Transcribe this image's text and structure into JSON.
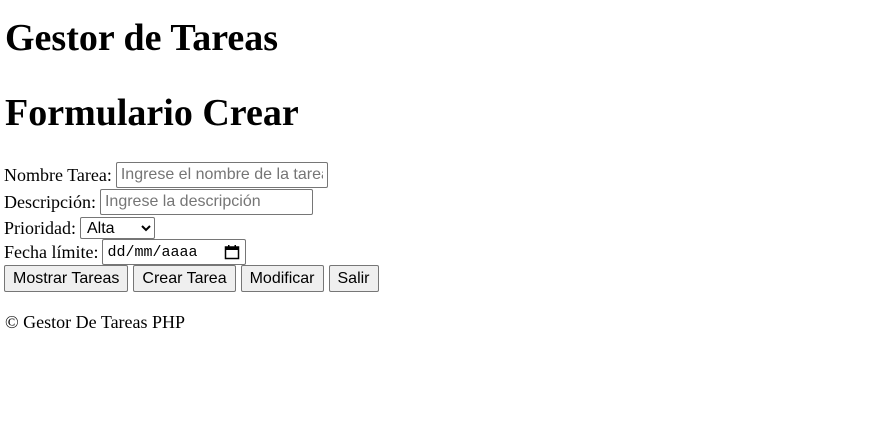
{
  "header": {
    "title": "Gestor de Tareas",
    "subtitle": "Formulario Crear"
  },
  "form": {
    "name": {
      "label": "Nombre Tarea:",
      "value": "",
      "placeholder": "Ingrese el nombre de la tarea"
    },
    "description": {
      "label": "Descripción:",
      "value": "",
      "placeholder": "Ingrese la descripción"
    },
    "priority": {
      "label": "Prioridad:",
      "selected": "Alta"
    },
    "due_date": {
      "label": "Fecha límite:",
      "placeholder": "dd/mm/aaaa",
      "icon": "calendar-icon"
    }
  },
  "buttons": {
    "show": "Mostrar Tareas",
    "create": "Crear Tarea",
    "modify": "Modificar",
    "exit": "Salir"
  },
  "footer": {
    "text": "© Gestor De Tareas PHP"
  }
}
